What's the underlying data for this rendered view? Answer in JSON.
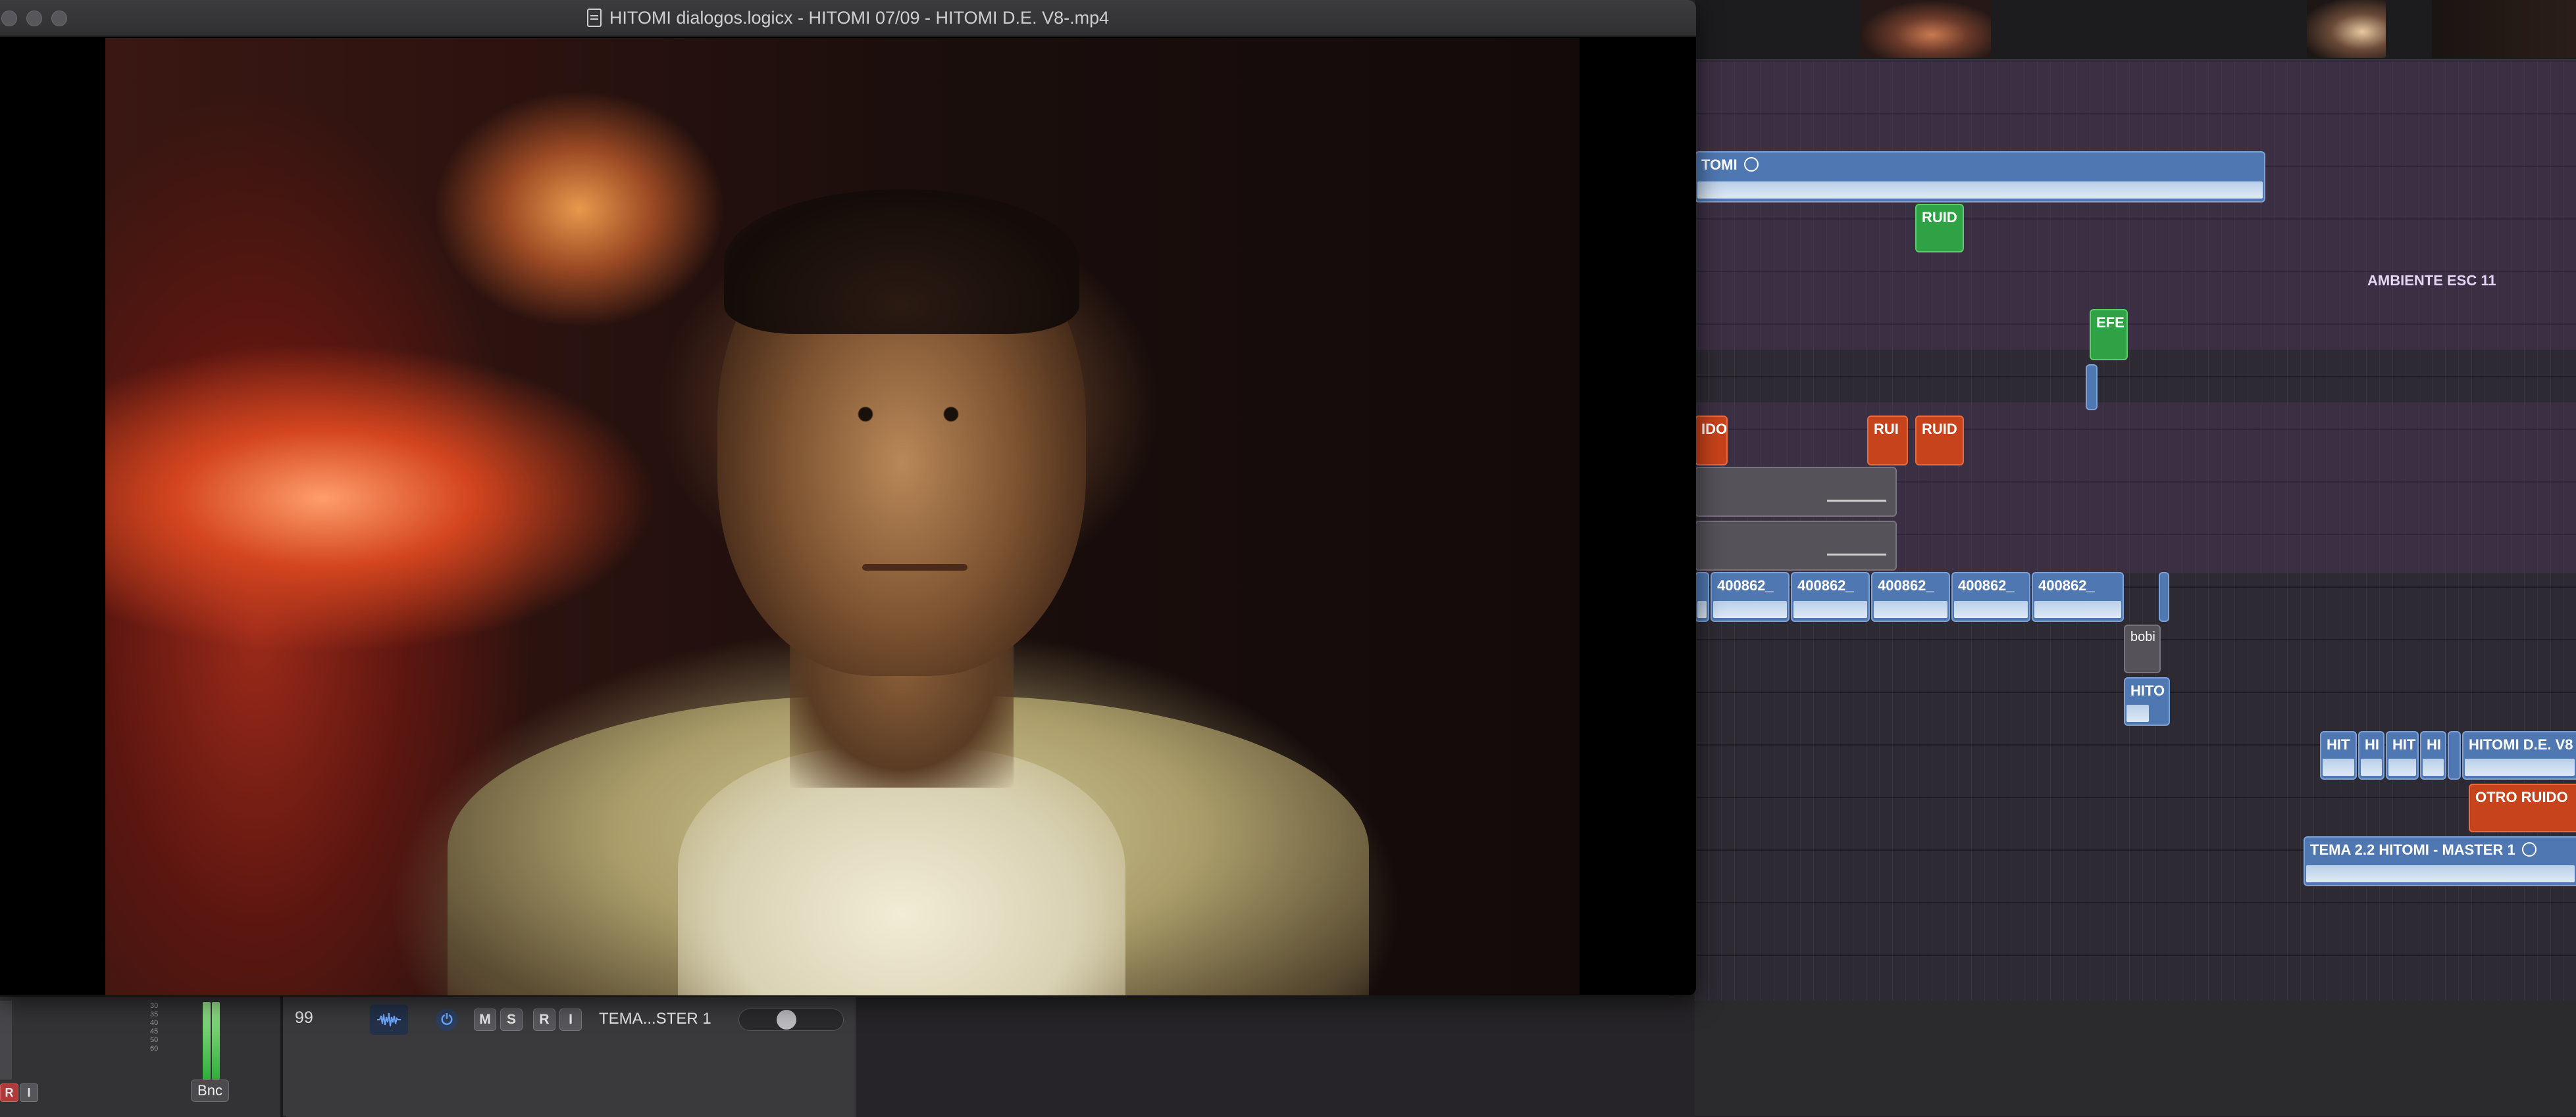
{
  "window": {
    "title": "HITOMI dialogos.logicx - HITOMI 07/09 - HITOMI D.E. V8-.mp4"
  },
  "arrange": {
    "regions": {
      "hitomi_main": "TOMI",
      "ruid_green_1": "RUID",
      "efe_green": "EFE",
      "ido_red": "IDO",
      "rui_red": "RUI",
      "ruid_red": "RUID",
      "clip1": "400862_",
      "clip2": "400862_",
      "clip3": "400862_",
      "clip4": "400862_",
      "clip5": "400862_",
      "bobi": "bobi",
      "hito": "HITO",
      "hit1": "HIT",
      "hi1": "HI",
      "hit2": "HIT",
      "hi2": "HI",
      "hitomi_de": "HITOMI D.E. V8",
      "otro_ruido": "OTRO RUIDO",
      "tema_master": "TEMA 2.2 HITOMI - MASTER 1"
    },
    "marker_ambiente": "AMBIENTE ESC 11"
  },
  "mixer": {
    "meter_scale": [
      "30",
      "35",
      "40",
      "45",
      "50",
      "60"
    ],
    "record_label": "R",
    "input_label": "I",
    "bnc_label": "Bnc"
  },
  "track_header": {
    "number": "99",
    "mute_label": "M",
    "solo_label": "S",
    "record_label": "R",
    "input_label": "I",
    "name": "TEMA...STER 1"
  },
  "colors": {
    "region_blue": "#4f78b2",
    "region_green": "#2fa246",
    "region_red": "#c7431c",
    "region_grey": "#55525a"
  }
}
